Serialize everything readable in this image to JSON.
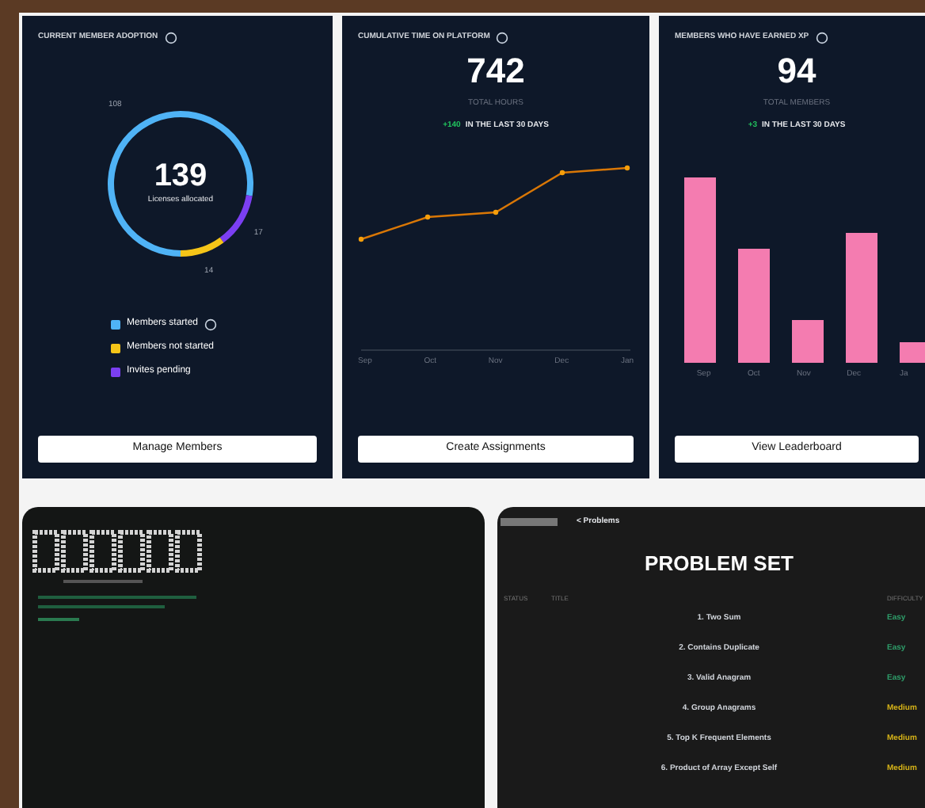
{
  "adoption_card": {
    "title": "CURRENT MEMBER ADOPTION",
    "total": "139",
    "total_label": "Licenses allocated",
    "chart_data": {
      "type": "donut",
      "categories": [
        "Members started",
        "Members not started",
        "Invites pending"
      ],
      "values": [
        108,
        14,
        17
      ],
      "data_labels": true
    },
    "legend": [
      {
        "color": "#4fb3f6",
        "info": true
      },
      {
        "color": "#f5c518",
        "info": false
      },
      {
        "color": "#7b3ff2",
        "info": false
      }
    ],
    "button": "Manage Members"
  },
  "time_card": {
    "title": "CUMULATIVE TIME ON PLATFORM",
    "value": "742",
    "value_label": "TOTAL HOURS",
    "delta": "+140",
    "delta_label": "IN THE LAST 30 DAYS",
    "months": [
      "Sep",
      "Oct",
      "Nov",
      "Dec",
      "Jan"
    ],
    "button": "Create Assignments"
  },
  "xp_card": {
    "title": "MEMBERS WHO HAVE EARNED XP",
    "value": "94",
    "value_label": "TOTAL MEMBERS",
    "delta": "+3",
    "delta_label": "IN THE LAST 30 DAYS",
    "months": [
      "Sep",
      "Oct",
      "Nov",
      "Dec",
      "Ja"
    ],
    "button": "View Leaderboard"
  },
  "problem_set": {
    "back": "< Problems",
    "title": "PROBLEM SET",
    "columns": [
      "STATUS",
      "TITLE",
      "DIFFICULTY"
    ],
    "rows": [
      {
        "title": "1. Two Sum",
        "difficulty": "Easy",
        "color": "#2e9e6a"
      },
      {
        "title": "2. Contains Duplicate",
        "difficulty": "Easy",
        "color": "#2e9e6a"
      },
      {
        "title": "3. Valid Anagram",
        "difficulty": "Easy",
        "color": "#2e9e6a"
      },
      {
        "title": "4. Group Anagrams",
        "difficulty": "Medium",
        "color": "#d6b318"
      },
      {
        "title": "5. Top K Frequent Elements",
        "difficulty": "Medium",
        "color": "#d6b318"
      },
      {
        "title": "6. Product of Array Except Self",
        "difficulty": "Medium",
        "color": "#d6b318"
      }
    ]
  }
}
